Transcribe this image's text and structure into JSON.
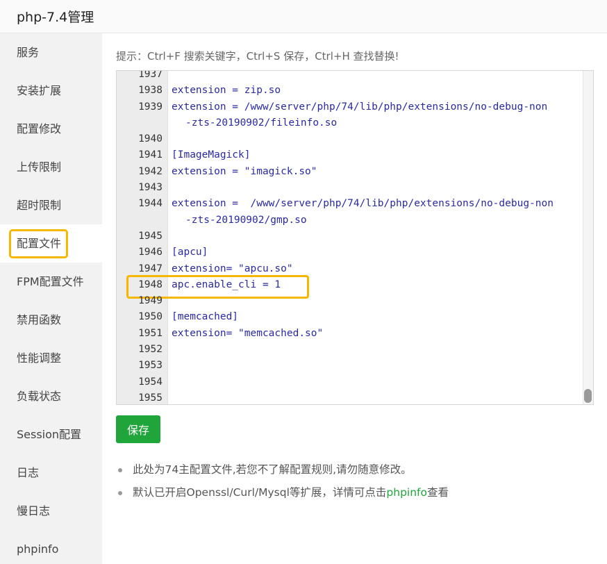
{
  "window": {
    "title": "php-7.4管理"
  },
  "sidebar": {
    "items": [
      {
        "label": "服务"
      },
      {
        "label": "安装扩展"
      },
      {
        "label": "配置修改"
      },
      {
        "label": "上传限制"
      },
      {
        "label": "超时限制"
      },
      {
        "label": "配置文件",
        "active": true
      },
      {
        "label": "FPM配置文件"
      },
      {
        "label": "禁用函数"
      },
      {
        "label": "性能调整"
      },
      {
        "label": "负载状态"
      },
      {
        "label": "Session配置"
      },
      {
        "label": "日志"
      },
      {
        "label": "慢日志"
      },
      {
        "label": "phpinfo"
      }
    ]
  },
  "main": {
    "hint": "提示：Ctrl+F 搜索关键字，Ctrl+S 保存，Ctrl+H 查找替换!",
    "editor": {
      "lines": [
        {
          "n": "1937",
          "text": ""
        },
        {
          "n": "1938",
          "text": "extension = zip.so"
        },
        {
          "n": "1939",
          "text": "extension = /www/server/php/74/lib/php/extensions/no-debug-non",
          "wrap": "-zts-20190902/fileinfo.so"
        },
        {
          "n": "1940",
          "text": ""
        },
        {
          "n": "1941",
          "text": "[ImageMagick]"
        },
        {
          "n": "1942",
          "text": "extension = \"imagick.so\""
        },
        {
          "n": "1943",
          "text": ""
        },
        {
          "n": "1944",
          "text": "extension =  /www/server/php/74/lib/php/extensions/no-debug-non",
          "wrap": "-zts-20190902/gmp.so"
        },
        {
          "n": "1945",
          "text": ""
        },
        {
          "n": "1946",
          "text": "[apcu]"
        },
        {
          "n": "1947",
          "text": "extension= \"apcu.so\""
        },
        {
          "n": "1948",
          "text": "apc.enable_cli = 1"
        },
        {
          "n": "1949",
          "text": ""
        },
        {
          "n": "1950",
          "text": "[memcached]"
        },
        {
          "n": "1951",
          "text": "extension= \"memcached.so\""
        },
        {
          "n": "1952",
          "text": ""
        },
        {
          "n": "1953",
          "text": ""
        },
        {
          "n": "1954",
          "text": ""
        },
        {
          "n": "1955",
          "text": ""
        }
      ]
    },
    "save_label": "保存",
    "notes": {
      "note1": "此处为74主配置文件,若您不了解配置规则,请勿随意修改。",
      "note2_prefix": "默认已开启Openssl/Curl/Mysql等扩展，详情可点击",
      "note2_link": "phpinfo",
      "note2_suffix": "查看"
    }
  },
  "colors": {
    "accent": "#20a53a",
    "highlight": "#f5b700",
    "code": "#2a2aa0"
  }
}
